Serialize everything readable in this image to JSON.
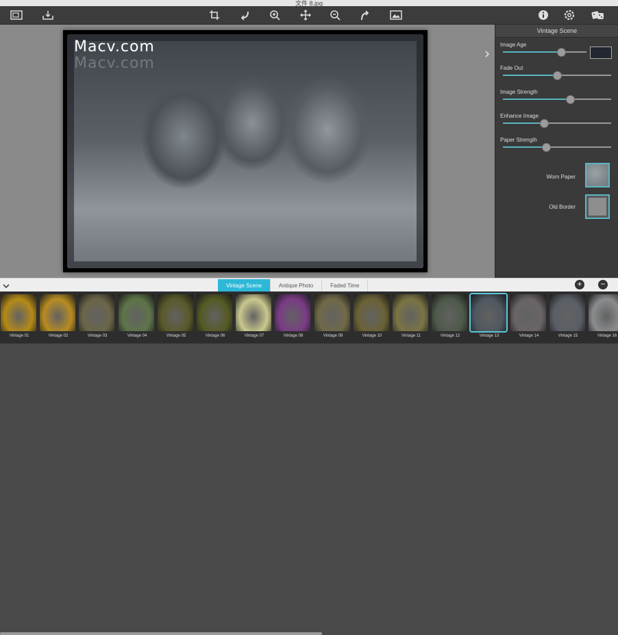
{
  "window": {
    "title": "文件 8.jpg"
  },
  "toolbar": {
    "left": [
      {
        "icon": "open-image-icon"
      },
      {
        "icon": "export-icon"
      }
    ],
    "center": [
      {
        "icon": "crop-icon"
      },
      {
        "icon": "rotate-left-icon"
      },
      {
        "icon": "zoom-in-icon"
      },
      {
        "icon": "move-icon"
      },
      {
        "icon": "zoom-out-icon"
      },
      {
        "icon": "rotate-right-icon"
      },
      {
        "icon": "compare-icon"
      }
    ],
    "right": [
      {
        "icon": "info-icon"
      },
      {
        "icon": "settings-icon"
      },
      {
        "icon": "random-icon"
      }
    ]
  },
  "canvas": {
    "watermark": "Macv.com",
    "watermark_shadow": "Macv.com"
  },
  "panel": {
    "title": "Vintage Scene",
    "sliders": [
      {
        "label": "Image Age",
        "value": 0.7
      },
      {
        "label": "Fade Out",
        "value": 0.5
      },
      {
        "label": "Image Strength",
        "value": 0.62
      },
      {
        "label": "Enhance Image",
        "value": 0.38
      },
      {
        "label": "Paper Strength",
        "value": 0.4
      }
    ],
    "color_swatch": "#23272f",
    "textures": [
      {
        "label": "Worn Paper"
      },
      {
        "label": "Old Border"
      }
    ]
  },
  "tabs": {
    "items": [
      "Vintage Scene",
      "Antique Photo",
      "Faded Time"
    ],
    "active": 0
  },
  "bottom_buttons": {
    "add": "+",
    "remove": "−"
  },
  "filmstrip": {
    "selected": 12,
    "items": [
      {
        "label": "Vintage 01",
        "color": "#b58a18"
      },
      {
        "label": "Vintage 02",
        "color": "#b88c22"
      },
      {
        "label": "Vintage 03",
        "color": "#6b6648"
      },
      {
        "label": "Vintage 04",
        "color": "#5e7448"
      },
      {
        "label": "Vintage 05",
        "color": "#5a5a2a"
      },
      {
        "label": "Vintage 06",
        "color": "#565a24"
      },
      {
        "label": "Vintage 07",
        "color": "#c9c88e"
      },
      {
        "label": "Vintage 08",
        "color": "#7a3c86"
      },
      {
        "label": "Vintage 09",
        "color": "#706a48"
      },
      {
        "label": "Vintage 10",
        "color": "#6a6236"
      },
      {
        "label": "Vintage 11",
        "color": "#7a7444"
      },
      {
        "label": "Vintage 12",
        "color": "#4e5a4a"
      },
      {
        "label": "Vintage 13",
        "color": "#4f5760"
      },
      {
        "label": "Vintage 14",
        "color": "#6a6466"
      },
      {
        "label": "Vintage 15",
        "color": "#5a5e66"
      },
      {
        "label": "Vintage 16",
        "color": "#8a8c8e"
      }
    ]
  },
  "accent": "#2eb8d8"
}
